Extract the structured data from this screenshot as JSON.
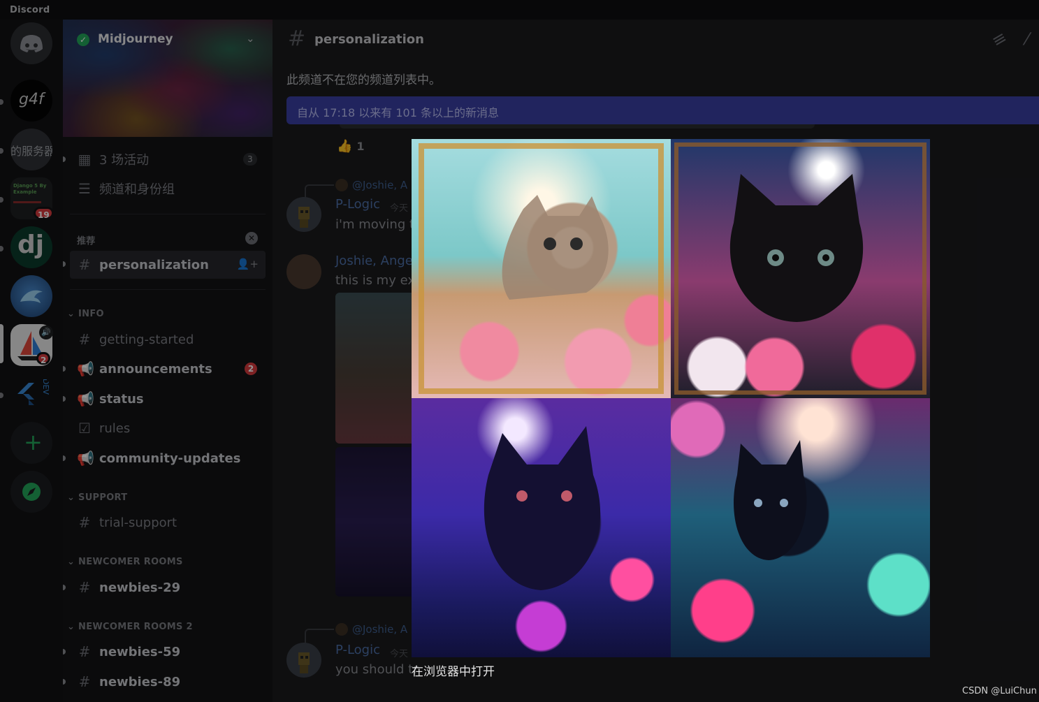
{
  "app": {
    "title": "Discord"
  },
  "servers": [
    {
      "name": "direct-messages",
      "label": ""
    },
    {
      "name": "g4f",
      "label": "g4f"
    },
    {
      "name": "my-server",
      "label": "的服务器"
    },
    {
      "name": "django-by-example",
      "label": "Django 5 By Example",
      "badge": "19"
    },
    {
      "name": "dj",
      "label": "dj"
    },
    {
      "name": "dolphin",
      "label": ""
    },
    {
      "name": "midjourney",
      "label": "",
      "badge": "2"
    },
    {
      "name": "flutter-dev",
      "label": "DEV"
    },
    {
      "name": "add-server",
      "label": "+"
    },
    {
      "name": "discover",
      "label": ""
    }
  ],
  "sidebar": {
    "server_name": "Midjourney",
    "events": {
      "label": "3 场活动",
      "count": "3"
    },
    "channels_roles": "频道和身份组",
    "recommended": {
      "title": "推荐",
      "channel": "personalization"
    },
    "categories": [
      {
        "title": "INFO",
        "channels": [
          "getting-started",
          "announcements",
          "status",
          "rules",
          "community-updates"
        ]
      },
      {
        "title": "SUPPORT",
        "channels": [
          "trial-support"
        ]
      },
      {
        "title": "NEWCOMER ROOMS",
        "channels": [
          "newbies-29"
        ]
      },
      {
        "title": "NEWCOMER ROOMS 2",
        "channels": [
          "newbies-59",
          "newbies-89"
        ]
      }
    ],
    "announcements_badge": "2"
  },
  "channel": {
    "name": "personalization",
    "notice": "此频道不在您的频道列表中。",
    "new_messages": "自从 17:18 以来有 101 条以上的新消息",
    "reaction": {
      "emoji": "👍",
      "count": "1"
    }
  },
  "messages": [
    {
      "reply": "@Joshie, A",
      "author": "P-Logic",
      "time": "今天",
      "text": "i'm moving to"
    },
    {
      "author": "Joshie, Ange",
      "text": "this is my exc"
    },
    {
      "reply": "@Joshie, A",
      "author": "P-Logic",
      "time": "今天",
      "text": "you should tr"
    }
  ],
  "viewer": {
    "open_in_browser": "在浏览器中打开"
  },
  "watermark": "CSDN @LuiChun"
}
